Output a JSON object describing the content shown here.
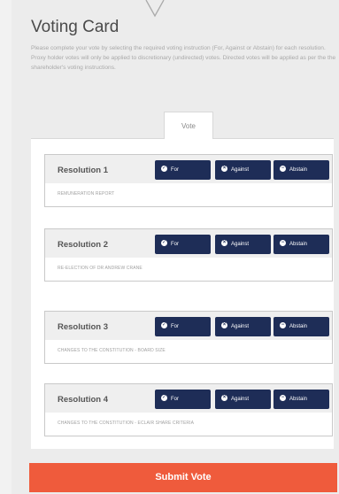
{
  "header": {
    "title": "Voting Card",
    "instructions": "Please complete your vote by selecting the required voting instruction (For, Against or Abstain) for each resolution. Proxy holder votes will only be applied to discretionary (undirected) votes. Directed votes will be applied as per the the shareholder's voting instructions."
  },
  "tabs": {
    "vote_label": "Vote"
  },
  "resolutions": [
    {
      "title": "Resolution 1",
      "description": "REMUNERATION REPORT",
      "for_label": "For",
      "against_label": "Against",
      "abstain_label": "Abstain"
    },
    {
      "title": "Resolution 2",
      "description": "RE-ELECTION OF DR ANDREW CRANE",
      "for_label": "For",
      "against_label": "Against",
      "abstain_label": "Abstain"
    },
    {
      "title": "Resolution 3",
      "description": "CHANGES TO THE CONSTITUTION - BOARD SIZE",
      "for_label": "For",
      "against_label": "Against",
      "abstain_label": "Abstain"
    },
    {
      "title": "Resolution 4",
      "description": "CHANGES TO THE CONSTITUTION - ECLAIR SHARE CRITERIA",
      "for_label": "For",
      "against_label": "Against",
      "abstain_label": "Abstain"
    }
  ],
  "footer": {
    "submit_label": "Submit Vote"
  },
  "colors": {
    "button_navy": "#1e2d57",
    "submit_orange": "#ef5b3c",
    "page_bg": "#ececec"
  }
}
